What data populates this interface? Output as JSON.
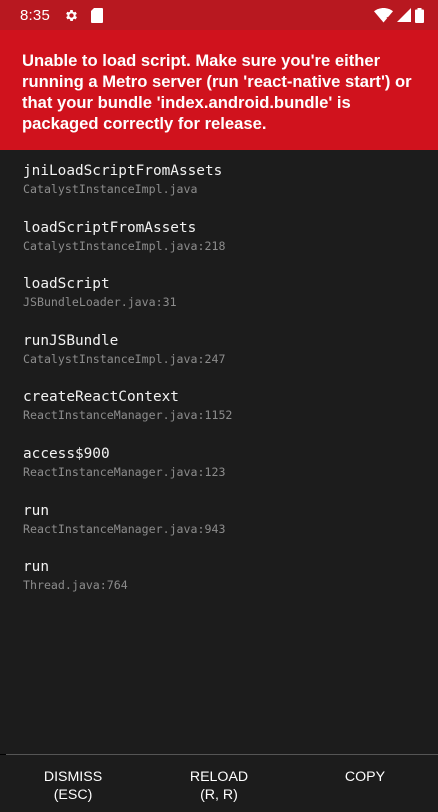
{
  "status_bar": {
    "time": "8:35",
    "icons": [
      "gear-icon",
      "sd-card-icon",
      "wifi-icon",
      "cellular-icon",
      "battery-icon"
    ]
  },
  "error": {
    "message": "Unable to load script. Make sure you're either running a Metro server (run 'react-native start') or that your bundle 'index.android.bundle' is packaged correctly for release."
  },
  "stack_trace": [
    {
      "method": "jniLoadScriptFromAssets",
      "location": "CatalystInstanceImpl.java"
    },
    {
      "method": "loadScriptFromAssets",
      "location": "CatalystInstanceImpl.java:218"
    },
    {
      "method": "loadScript",
      "location": "JSBundleLoader.java:31"
    },
    {
      "method": "runJSBundle",
      "location": "CatalystInstanceImpl.java:247"
    },
    {
      "method": "createReactContext",
      "location": "ReactInstanceManager.java:1152"
    },
    {
      "method": "access$900",
      "location": "ReactInstanceManager.java:123"
    },
    {
      "method": "run",
      "location": "ReactInstanceManager.java:943"
    },
    {
      "method": "run",
      "location": "Thread.java:764"
    }
  ],
  "buttons": {
    "dismiss": {
      "label": "DISMISS",
      "shortcut": "(ESC)"
    },
    "reload": {
      "label": "RELOAD",
      "shortcut": "(R, R)"
    },
    "copy": {
      "label": "COPY"
    }
  },
  "colors": {
    "status_bar": "#b81820",
    "error_banner": "#d0121d",
    "panel": "#1c1c1c",
    "method_text": "#f2f2f2",
    "location_text": "#8c8c8c"
  }
}
